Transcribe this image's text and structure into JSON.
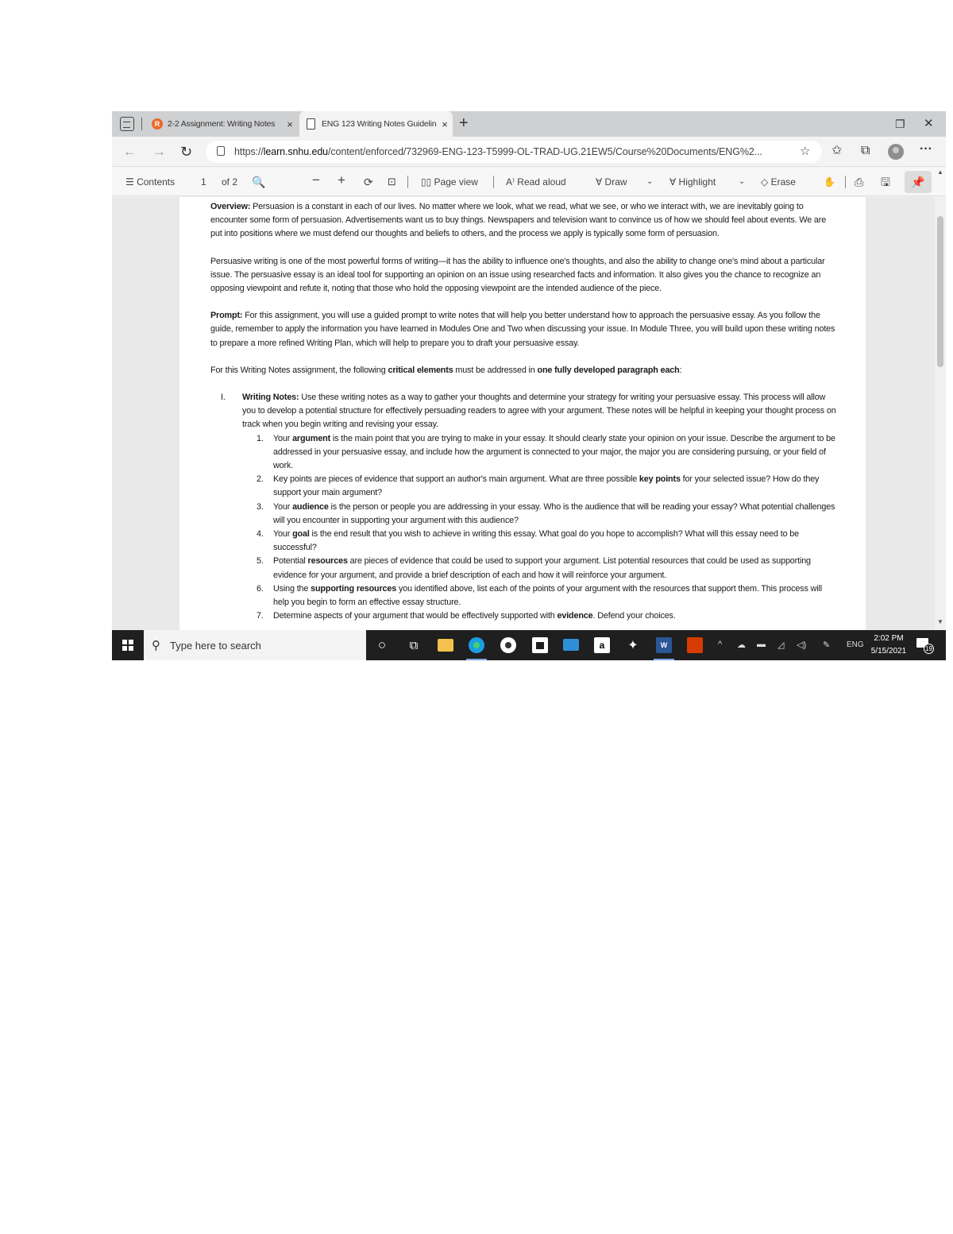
{
  "browser": {
    "tabs": [
      {
        "favicon": "R",
        "title": "2-2 Assignment: Writing Notes",
        "close": "×"
      },
      {
        "title": "ENG 123 Writing Notes Guidelin",
        "close": "×"
      }
    ],
    "new_tab": "+",
    "window_restore": "❐",
    "window_close": "✕",
    "nav": {
      "back": "←",
      "forward": "→",
      "reload": "↻"
    },
    "url_scheme": "https://",
    "url_host": "learn.snhu.edu",
    "url_path": "/content/enforced/732969-ENG-123-T5999-OL-TRAD-UG.21EW5/Course%20Documents/ENG%2...",
    "more": "···"
  },
  "pdf_toolbar": {
    "contents": "☰  Contents",
    "page_number": "1",
    "page_of": "of 2",
    "search": "🔍",
    "zoom_out": "−",
    "zoom_in": "+",
    "rotate": "⟳",
    "fit": "⊡",
    "page_view": "▯▯  Page view",
    "read_aloud": "A⁾  Read aloud",
    "draw": "∀  Draw",
    "draw_chev": "⌄",
    "highlight": "∀  Highlight",
    "highlight_chev": "⌄",
    "erase": "◇  Erase",
    "touch": "✋",
    "print": "⎙",
    "save": "🖫",
    "pin": "📌"
  },
  "document": {
    "overview_label": "Overview:",
    "overview_text": "Persuasion is a constant in each of our lives. No matter where we look, what we read, what we see, or who we interact with, we are inevitably going to encounter some form of persuasion. Advertisements want us to buy things. Newspapers and television want to convince us of how we should feel about events. We are put into positions where we must defend our thoughts and beliefs to others, and the process we apply is typically some form of persuasion.",
    "paragraph2": "Persuasive writing is one of the most powerful forms of writing—it has the ability to influence one's thoughts, and also the ability to change one's mind about a particular issue. The persuasive essay is an ideal tool for supporting an opinion on an issue using researched facts and information. It also gives you the chance to recognize an opposing viewpoint and refute it, noting that those who hold the opposing viewpoint are the intended audience of the piece.",
    "prompt_label": "Prompt:",
    "prompt_text": "For this assignment, you will use a guided prompt to write notes that will help you better understand how to approach the persuasive essay. As you follow the guide, remember to apply the information you have learned in Modules One and Two when discussing your issue. In Module Three, you will build upon these writing notes to prepare a more refined Writing Plan, which will help to prepare you to draft your persuasive essay.",
    "critical_intro_a": "For this Writing Notes assignment, the following ",
    "critical_intro_b": "critical elements",
    "critical_intro_c": " must be addressed in ",
    "critical_intro_d": "one fully developed paragraph each",
    "critical_intro_e": ":",
    "item_numeral": "I.",
    "item_label": "Writing Notes:",
    "item_text": "Use these writing notes as a way to gather your thoughts and determine your strategy for writing your persuasive essay. This process will allow you to develop a potential structure for effectively persuading readers to agree with your argument. These notes will be helpful in keeping your thought process on track when you begin writing and revising your essay.",
    "sub_items": [
      {
        "num": "1.",
        "a": "Your ",
        "b": "argument",
        "c": " is the main point that you are trying to make in your essay. It should clearly state your opinion on your issue. Describe the argument to be addressed in your persuasive essay, and include how the argument is connected to your major, the major you are considering pursuing, or your field of work."
      },
      {
        "num": "2.",
        "a": "Key points are pieces of evidence that support an author's main argument. What are three possible ",
        "b": "key points",
        "c": " for your selected issue? How do they support your main argument?"
      },
      {
        "num": "3.",
        "a": "Your ",
        "b": "audience",
        "c": " is the person or people you are addressing in your essay. Who is the audience that will be reading your essay? What potential challenges will you encounter in supporting your argument with this audience?"
      },
      {
        "num": "4.",
        "a": "Your ",
        "b": "goal",
        "c": " is the end result that you wish to achieve in writing this essay. What goal do you hope to accomplish? What will this essay need to be successful?"
      },
      {
        "num": "5.",
        "a": "Potential ",
        "b": "resources",
        "c": " are pieces of evidence that could be used to support your argument. List potential resources that could be used as supporting evidence for your argument, and provide a brief description of each and how it will reinforce your argument."
      },
      {
        "num": "6.",
        "a": "Using the ",
        "b": "supporting resources",
        "c": " you identified above, list each of the points of your argument with the resources that support them. This process will help you begin to form an effective essay structure."
      },
      {
        "num": "7.",
        "a": "Determine aspects of your argument that would be effectively supported with ",
        "b": "evidence",
        "c": ". Defend your choices."
      }
    ]
  },
  "scrollbar": {
    "up": "▲",
    "down": "▼",
    "thumb_fraction": 0.35
  },
  "taskbar": {
    "search_placeholder": "Type here to search",
    "search_glyph": "⚲",
    "cortana": "○",
    "task_view": "⧉",
    "amazon": "a",
    "word": "W",
    "dropbox": "✦",
    "tray_chev": "^",
    "onedrive": "☁",
    "battery": "▬",
    "network": "◿",
    "volume": "◁)",
    "pen": "✎",
    "language": "ENG",
    "time": "2:02 PM",
    "date": "5/15/2021",
    "notification_count": "19"
  }
}
